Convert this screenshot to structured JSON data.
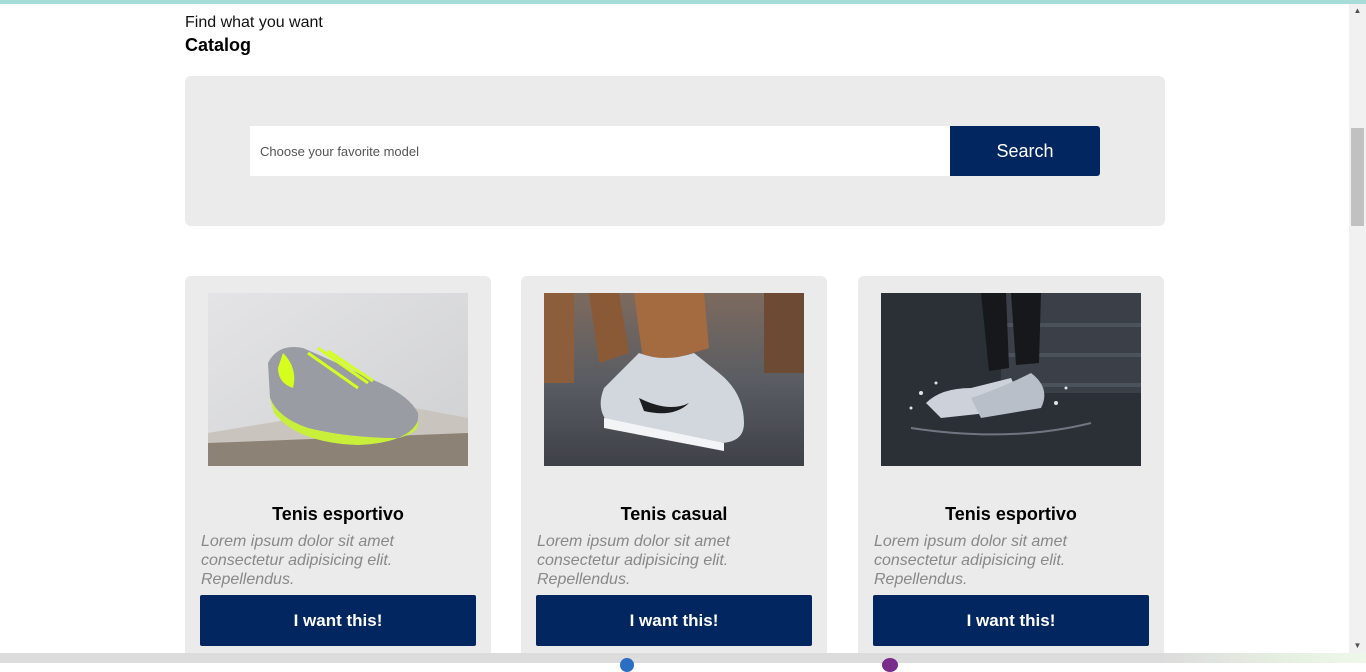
{
  "header": {
    "subtitle": "Find what you want",
    "title": "Catalog"
  },
  "search": {
    "placeholder": "Choose your favorite model",
    "button_label": "Search"
  },
  "products": [
    {
      "image": "neon-running-shoe-photo",
      "title": "Tenis esportivo",
      "description": "Lorem ipsum dolor sit amet consectetur adipisicing elit. Repellendus.",
      "button_label": "I want this!"
    },
    {
      "image": "grey-sneaker-on-foot-photo",
      "title": "Tenis casual",
      "description": "Lorem ipsum dolor sit amet consectetur adipisicing elit. Repellendus.",
      "button_label": "I want this!"
    },
    {
      "image": "sneakers-splashing-water-photo",
      "title": "Tenis esportivo",
      "description": "Lorem ipsum dolor sit amet consectetur adipisicing elit. Repellendus.",
      "button_label": "I want this!"
    }
  ],
  "colors": {
    "primary": "#022660",
    "panel": "#ebebeb",
    "muted_text": "#888888"
  },
  "scrollbar": {
    "up_icon": "triangle-up-icon",
    "down_icon": "triangle-down-icon"
  }
}
